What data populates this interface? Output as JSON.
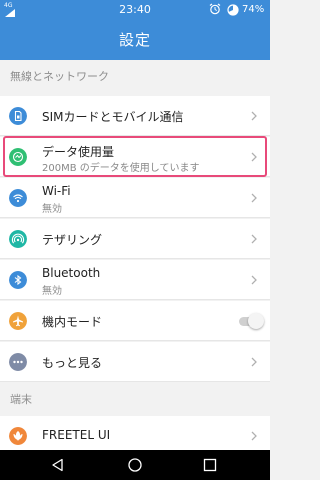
{
  "status_bar": {
    "network": "4G",
    "time": "23:40",
    "battery": "74%",
    "icons": [
      "signal-icon",
      "alarm-icon",
      "battery-icon"
    ]
  },
  "app_bar": {
    "title": "設定"
  },
  "sections": [
    {
      "header": "無線とネットワーク",
      "items": [
        {
          "label": "SIMカードとモバイル通信",
          "icon": "sim-card-icon",
          "color": "#3d8cd8"
        },
        {
          "label": "データ使用量",
          "sub": "200MB のデータを使用しています",
          "icon": "data-usage-icon",
          "color": "#2fbf73"
        },
        {
          "label": "Wi-Fi",
          "sub": "無効",
          "icon": "wifi-icon",
          "color": "#3d8cd8"
        },
        {
          "label": "テザリング",
          "icon": "tethering-icon",
          "color": "#1fb7a5"
        },
        {
          "label": "Bluetooth",
          "sub": "無効",
          "icon": "bluetooth-icon",
          "color": "#3d8cd8"
        },
        {
          "label": "機内モード",
          "icon": "airplane-icon",
          "color": "#f0a23a",
          "toggle": false
        },
        {
          "label": "もっと見る",
          "icon": "more-icon",
          "color": "#7f8ba6"
        }
      ]
    },
    {
      "header": "端末",
      "items": [
        {
          "label": "FREETEL UI",
          "icon": "freetel-icon",
          "color": "#f0873a"
        }
      ]
    }
  ],
  "nav_bar": {
    "icons": [
      "back-icon",
      "home-icon",
      "recents-icon"
    ]
  },
  "colors": {
    "accent": "#3d8cd8",
    "highlight": "#e84a7a"
  }
}
